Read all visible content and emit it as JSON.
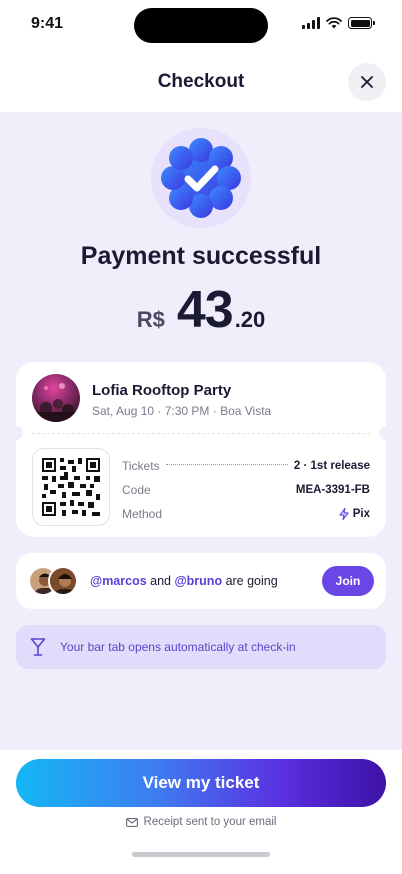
{
  "status_bar": {
    "time": "9:41"
  },
  "header": {
    "title": "Checkout",
    "close_icon": "close-icon"
  },
  "success": {
    "title": "Payment successful",
    "currency": "R$",
    "amount_integer": "43",
    "amount_decimal": ".20"
  },
  "ticket": {
    "event_name": "Lofia Rooftop Party",
    "event_meta": "Sat, Aug 10 · 7:30 PM · Boa Vista",
    "rows": [
      {
        "label": "Tickets",
        "value": "2 · 1st release"
      },
      {
        "label": "Code",
        "value": "MEA-3391-FB"
      },
      {
        "label": "Method",
        "value": "Pix"
      }
    ]
  },
  "friends": {
    "mention_1": "@marcos",
    "connector": " and ",
    "mention_2": "@bruno",
    "suffix": " are going",
    "join_label": "Join"
  },
  "notice": {
    "text": "Your bar tab opens automatically at check-in",
    "icon": "cocktail-glass-icon"
  },
  "bottom": {
    "cta_label": "View my ticket",
    "receipt_text": "Receipt sent to your email",
    "receipt_icon": "envelope-icon"
  },
  "colors": {
    "accent": "#6a46e6",
    "lavender_bg": "#f1eefc",
    "badge_blue": "#3b5cf0",
    "gradient_start": "#13b7f5",
    "gradient_end": "#3e12a6"
  }
}
